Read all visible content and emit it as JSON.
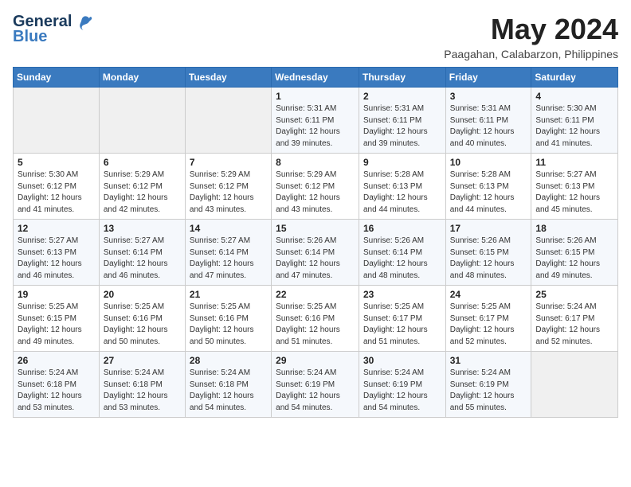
{
  "header": {
    "logo_line1": "General",
    "logo_line2": "Blue",
    "month_title": "May 2024",
    "location": "Paagahan, Calabarzon, Philippines"
  },
  "days_of_week": [
    "Sunday",
    "Monday",
    "Tuesday",
    "Wednesday",
    "Thursday",
    "Friday",
    "Saturday"
  ],
  "weeks": [
    [
      {
        "day": "",
        "info": ""
      },
      {
        "day": "",
        "info": ""
      },
      {
        "day": "",
        "info": ""
      },
      {
        "day": "1",
        "info": "Sunrise: 5:31 AM\nSunset: 6:11 PM\nDaylight: 12 hours and 39 minutes."
      },
      {
        "day": "2",
        "info": "Sunrise: 5:31 AM\nSunset: 6:11 PM\nDaylight: 12 hours and 39 minutes."
      },
      {
        "day": "3",
        "info": "Sunrise: 5:31 AM\nSunset: 6:11 PM\nDaylight: 12 hours and 40 minutes."
      },
      {
        "day": "4",
        "info": "Sunrise: 5:30 AM\nSunset: 6:11 PM\nDaylight: 12 hours and 41 minutes."
      }
    ],
    [
      {
        "day": "5",
        "info": "Sunrise: 5:30 AM\nSunset: 6:12 PM\nDaylight: 12 hours and 41 minutes."
      },
      {
        "day": "6",
        "info": "Sunrise: 5:29 AM\nSunset: 6:12 PM\nDaylight: 12 hours and 42 minutes."
      },
      {
        "day": "7",
        "info": "Sunrise: 5:29 AM\nSunset: 6:12 PM\nDaylight: 12 hours and 43 minutes."
      },
      {
        "day": "8",
        "info": "Sunrise: 5:29 AM\nSunset: 6:12 PM\nDaylight: 12 hours and 43 minutes."
      },
      {
        "day": "9",
        "info": "Sunrise: 5:28 AM\nSunset: 6:13 PM\nDaylight: 12 hours and 44 minutes."
      },
      {
        "day": "10",
        "info": "Sunrise: 5:28 AM\nSunset: 6:13 PM\nDaylight: 12 hours and 44 minutes."
      },
      {
        "day": "11",
        "info": "Sunrise: 5:27 AM\nSunset: 6:13 PM\nDaylight: 12 hours and 45 minutes."
      }
    ],
    [
      {
        "day": "12",
        "info": "Sunrise: 5:27 AM\nSunset: 6:13 PM\nDaylight: 12 hours and 46 minutes."
      },
      {
        "day": "13",
        "info": "Sunrise: 5:27 AM\nSunset: 6:14 PM\nDaylight: 12 hours and 46 minutes."
      },
      {
        "day": "14",
        "info": "Sunrise: 5:27 AM\nSunset: 6:14 PM\nDaylight: 12 hours and 47 minutes."
      },
      {
        "day": "15",
        "info": "Sunrise: 5:26 AM\nSunset: 6:14 PM\nDaylight: 12 hours and 47 minutes."
      },
      {
        "day": "16",
        "info": "Sunrise: 5:26 AM\nSunset: 6:14 PM\nDaylight: 12 hours and 48 minutes."
      },
      {
        "day": "17",
        "info": "Sunrise: 5:26 AM\nSunset: 6:15 PM\nDaylight: 12 hours and 48 minutes."
      },
      {
        "day": "18",
        "info": "Sunrise: 5:26 AM\nSunset: 6:15 PM\nDaylight: 12 hours and 49 minutes."
      }
    ],
    [
      {
        "day": "19",
        "info": "Sunrise: 5:25 AM\nSunset: 6:15 PM\nDaylight: 12 hours and 49 minutes."
      },
      {
        "day": "20",
        "info": "Sunrise: 5:25 AM\nSunset: 6:16 PM\nDaylight: 12 hours and 50 minutes."
      },
      {
        "day": "21",
        "info": "Sunrise: 5:25 AM\nSunset: 6:16 PM\nDaylight: 12 hours and 50 minutes."
      },
      {
        "day": "22",
        "info": "Sunrise: 5:25 AM\nSunset: 6:16 PM\nDaylight: 12 hours and 51 minutes."
      },
      {
        "day": "23",
        "info": "Sunrise: 5:25 AM\nSunset: 6:17 PM\nDaylight: 12 hours and 51 minutes."
      },
      {
        "day": "24",
        "info": "Sunrise: 5:25 AM\nSunset: 6:17 PM\nDaylight: 12 hours and 52 minutes."
      },
      {
        "day": "25",
        "info": "Sunrise: 5:24 AM\nSunset: 6:17 PM\nDaylight: 12 hours and 52 minutes."
      }
    ],
    [
      {
        "day": "26",
        "info": "Sunrise: 5:24 AM\nSunset: 6:18 PM\nDaylight: 12 hours and 53 minutes."
      },
      {
        "day": "27",
        "info": "Sunrise: 5:24 AM\nSunset: 6:18 PM\nDaylight: 12 hours and 53 minutes."
      },
      {
        "day": "28",
        "info": "Sunrise: 5:24 AM\nSunset: 6:18 PM\nDaylight: 12 hours and 54 minutes."
      },
      {
        "day": "29",
        "info": "Sunrise: 5:24 AM\nSunset: 6:19 PM\nDaylight: 12 hours and 54 minutes."
      },
      {
        "day": "30",
        "info": "Sunrise: 5:24 AM\nSunset: 6:19 PM\nDaylight: 12 hours and 54 minutes."
      },
      {
        "day": "31",
        "info": "Sunrise: 5:24 AM\nSunset: 6:19 PM\nDaylight: 12 hours and 55 minutes."
      },
      {
        "day": "",
        "info": ""
      }
    ]
  ]
}
